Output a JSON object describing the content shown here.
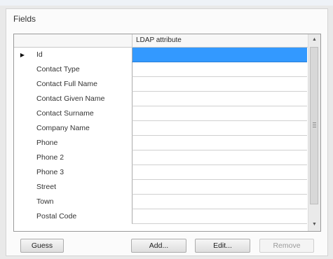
{
  "group": {
    "label": "Fields"
  },
  "grid": {
    "column_header": "LDAP attribute",
    "selected_marker": "▶",
    "rows": [
      {
        "name": "Id",
        "value": "",
        "selected": true
      },
      {
        "name": "Contact Type",
        "value": ""
      },
      {
        "name": "Contact Full Name",
        "value": ""
      },
      {
        "name": "Contact Given Name",
        "value": ""
      },
      {
        "name": "Contact Surname",
        "value": ""
      },
      {
        "name": "Company Name",
        "value": ""
      },
      {
        "name": "Phone",
        "value": ""
      },
      {
        "name": "Phone 2",
        "value": ""
      },
      {
        "name": "Phone 3",
        "value": ""
      },
      {
        "name": "Street",
        "value": ""
      },
      {
        "name": "Town",
        "value": ""
      },
      {
        "name": "Postal Code",
        "value": ""
      }
    ]
  },
  "scrollbar": {
    "up_icon": "scroll-up-arrow-icon",
    "down_icon": "scroll-down-arrow-icon"
  },
  "buttons": {
    "guess": "Guess",
    "add": "Add...",
    "edit": "Edit...",
    "remove": "Remove"
  },
  "colors": {
    "selection": "#3399ff",
    "panel": "#fbfbfb",
    "background": "#e9e9e9"
  }
}
